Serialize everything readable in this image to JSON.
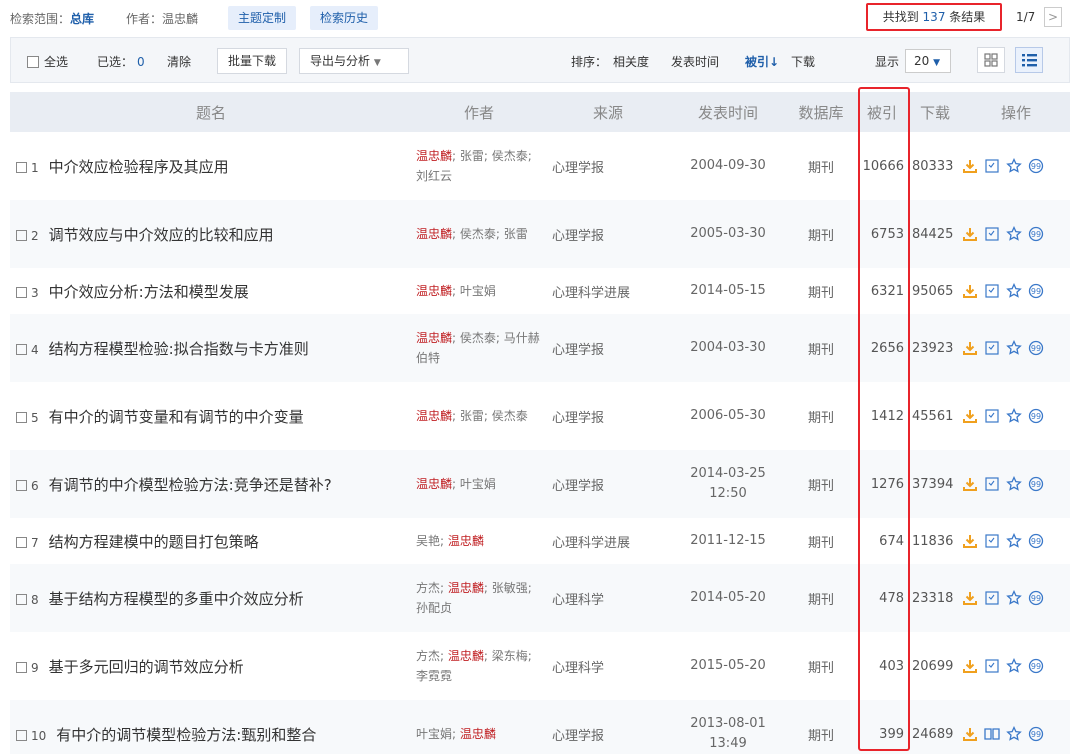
{
  "topbar": {
    "scope_label": "检索范围：",
    "scope_value": "总库",
    "author_label": "作者：温忠麟",
    "topic_button": "主题定制",
    "history_button": "检索历史",
    "result_prefix": "共找到",
    "result_count": "137",
    "result_suffix": "条结果",
    "pager": "1/7",
    "next_icon": ">"
  },
  "toolbar": {
    "select_all": "全选",
    "selected_label": "已选：",
    "selected_count": "0",
    "clear": "清除",
    "batch_download": "批量下载",
    "export": "导出与分析",
    "export_caret": "▼",
    "sort_label": "排序：",
    "sort_relevance": "相关度",
    "sort_time": "发表时间",
    "sort_cited": "被引",
    "sort_cited_arrow": "↓",
    "sort_download": "下载",
    "display_label": "显示",
    "page_size": "20",
    "page_size_caret": "▼"
  },
  "table": {
    "headers": [
      "题名",
      "作者",
      "来源",
      "发表时间",
      "数据库",
      "被引",
      "下载",
      "操作"
    ],
    "rows": [
      {
        "idx": "1",
        "title": "中介效应检验程序及其应用",
        "authors": [
          {
            "n": "温忠麟",
            "hl": true
          },
          {
            "n": "; 张雷; 侯杰泰; 刘红云",
            "hl": false
          }
        ],
        "source": "心理学报",
        "date": "2004-09-30",
        "db": "期刊",
        "cited": "10666",
        "downloads": "80333",
        "op2": "html"
      },
      {
        "idx": "2",
        "title": "调节效应与中介效应的比较和应用",
        "authors": [
          {
            "n": "温忠麟",
            "hl": true
          },
          {
            "n": "; 侯杰泰; 张雷",
            "hl": false
          }
        ],
        "source": "心理学报",
        "date": "2005-03-30",
        "db": "期刊",
        "cited": "6753",
        "downloads": "84425",
        "op2": "html"
      },
      {
        "idx": "3",
        "title": "中介效应分析:方法和模型发展",
        "authors": [
          {
            "n": "温忠麟",
            "hl": true
          },
          {
            "n": "; 叶宝娟",
            "hl": false
          }
        ],
        "source": "心理科学进展",
        "date": "2014-05-15",
        "db": "期刊",
        "cited": "6321",
        "downloads": "95065",
        "op2": "html"
      },
      {
        "idx": "4",
        "title": "结构方程模型检验:拟合指数与卡方准则",
        "authors": [
          {
            "n": "温忠麟",
            "hl": true
          },
          {
            "n": "; 侯杰泰; 马什赫伯特",
            "hl": false
          }
        ],
        "source": "心理学报",
        "date": "2004-03-30",
        "db": "期刊",
        "cited": "2656",
        "downloads": "23923",
        "op2": "html"
      },
      {
        "idx": "5",
        "title": "有中介的调节变量和有调节的中介变量",
        "authors": [
          {
            "n": "温忠麟",
            "hl": true
          },
          {
            "n": "; 张雷; 侯杰泰",
            "hl": false
          }
        ],
        "source": "心理学报",
        "date": "2006-05-30",
        "db": "期刊",
        "cited": "1412",
        "downloads": "45561",
        "op2": "html"
      },
      {
        "idx": "6",
        "title": "有调节的中介模型检验方法:竞争还是替补?",
        "authors": [
          {
            "n": "温忠麟",
            "hl": true
          },
          {
            "n": "; 叶宝娟",
            "hl": false
          }
        ],
        "source": "心理学报",
        "date": "2014-03-25 12:50",
        "db": "期刊",
        "cited": "1276",
        "downloads": "37394",
        "op2": "html"
      },
      {
        "idx": "7",
        "title": "结构方程建模中的题目打包策略",
        "authors": [
          {
            "n": "吴艳; ",
            "hl": false
          },
          {
            "n": "温忠麟",
            "hl": true
          }
        ],
        "source": "心理科学进展",
        "date": "2011-12-15",
        "db": "期刊",
        "cited": "674",
        "downloads": "11836",
        "op2": "html"
      },
      {
        "idx": "8",
        "title": "基于结构方程模型的多重中介效应分析",
        "authors": [
          {
            "n": "方杰; ",
            "hl": false
          },
          {
            "n": "温忠麟",
            "hl": true
          },
          {
            "n": "; 张敏强; 孙配贞",
            "hl": false
          }
        ],
        "source": "心理科学",
        "date": "2014-05-20",
        "db": "期刊",
        "cited": "478",
        "downloads": "23318",
        "op2": "html"
      },
      {
        "idx": "9",
        "title": "基于多元回归的调节效应分析",
        "authors": [
          {
            "n": "方杰; ",
            "hl": false
          },
          {
            "n": "温忠麟",
            "hl": true
          },
          {
            "n": "; 梁东梅; 李霓霓",
            "hl": false
          }
        ],
        "source": "心理科学",
        "date": "2015-05-20",
        "db": "期刊",
        "cited": "403",
        "downloads": "20699",
        "op2": "html"
      },
      {
        "idx": "10",
        "title": "有中介的调节模型检验方法:甄别和整合",
        "authors": [
          {
            "n": "叶宝娟; ",
            "hl": false
          },
          {
            "n": "温忠麟",
            "hl": true
          }
        ],
        "source": "心理学报",
        "date": "2013-08-01 13:49",
        "db": "期刊",
        "cited": "399",
        "downloads": "24689",
        "op2": "book"
      }
    ]
  },
  "colors": {
    "accent": "#1f5faa",
    "highlight": "#e8242b",
    "author_red": "#c01f22",
    "download_orange": "#f0a01e"
  }
}
